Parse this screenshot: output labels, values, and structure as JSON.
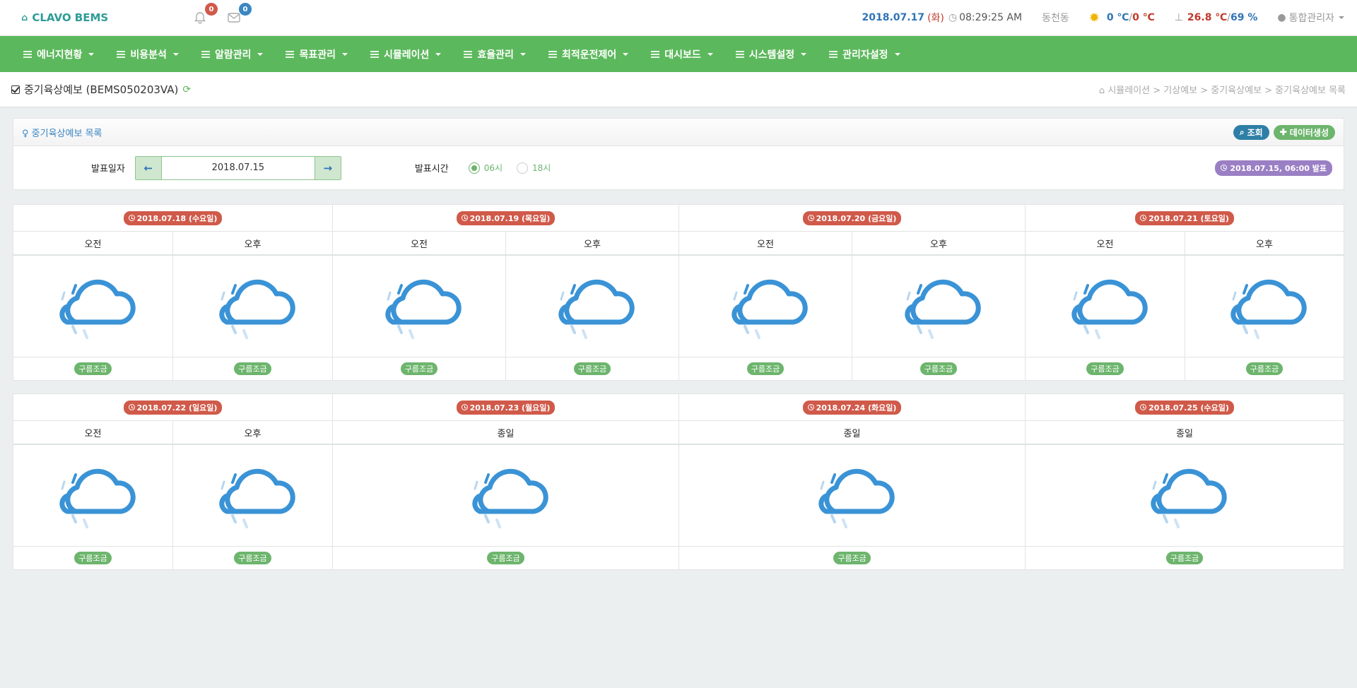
{
  "header": {
    "brand": "CLAVO BEMS",
    "alarm_count": "0",
    "message_count": "0",
    "date": "2018.07.17",
    "weekday": "(화)",
    "time": "08:29:25 AM",
    "location": "동천동",
    "outdoor_temp_1": "0 ℃",
    "outdoor_sep": " / ",
    "outdoor_temp_2": "0 ℃",
    "indoor_temp": "26.8 ℃",
    "indoor_sep": " / ",
    "indoor_humidity": "69 %",
    "user": "통합관리자"
  },
  "menu": [
    "에너지현황",
    "비용분석",
    "알람관리",
    "목표관리",
    "시뮬레이션",
    "효율관리",
    "최적운전제어",
    "대시보드",
    "시스템설정",
    "관리자설정"
  ],
  "page": {
    "title": "중기육상예보 (BEMS050203VA)",
    "breadcrumb": "시뮬레이션 > 기상예보 > 중기육상예보 > 중기육상예보 목록"
  },
  "panel": {
    "title": "중기육상예보 목록",
    "search_label": "조회",
    "generate_label": "데이터생성"
  },
  "filter": {
    "date_label": "발표일자",
    "date_value": "2018.07.15",
    "time_label": "발표시간",
    "radio_06": "06시",
    "radio_18": "18시",
    "published": "2018.07.15, 06:00 발표"
  },
  "table1": {
    "dates": [
      "2018.07.18 (수요일)",
      "2018.07.19 (목요일)",
      "2018.07.20 (금요일)",
      "2018.07.21 (토요일)"
    ],
    "periods": [
      "오전",
      "오후",
      "오전",
      "오후",
      "오전",
      "오후",
      "오전",
      "오후"
    ],
    "conditions": [
      "구름조금",
      "구름조금",
      "구름조금",
      "구름조금",
      "구름조금",
      "구름조금",
      "구름조금",
      "구름조금"
    ]
  },
  "table2": {
    "dates": [
      "2018.07.22 (일요일)",
      "2018.07.23 (월요일)",
      "2018.07.24 (화요일)",
      "2018.07.25 (수요일)"
    ],
    "periods": [
      "오전",
      "오후",
      "종일",
      "종일",
      "종일"
    ],
    "conditions": [
      "구름조금",
      "구름조금",
      "구름조금",
      "구름조금",
      "구름조금"
    ]
  },
  "colors": {
    "menu_bg": "#5cb85c",
    "brand": "#2e9c96",
    "date_badge": "#d05a4a",
    "weather_badge": "#6db56d",
    "weather_icon": "#3a93d6"
  },
  "icons": {
    "weather": "cloud-rain-icon"
  }
}
